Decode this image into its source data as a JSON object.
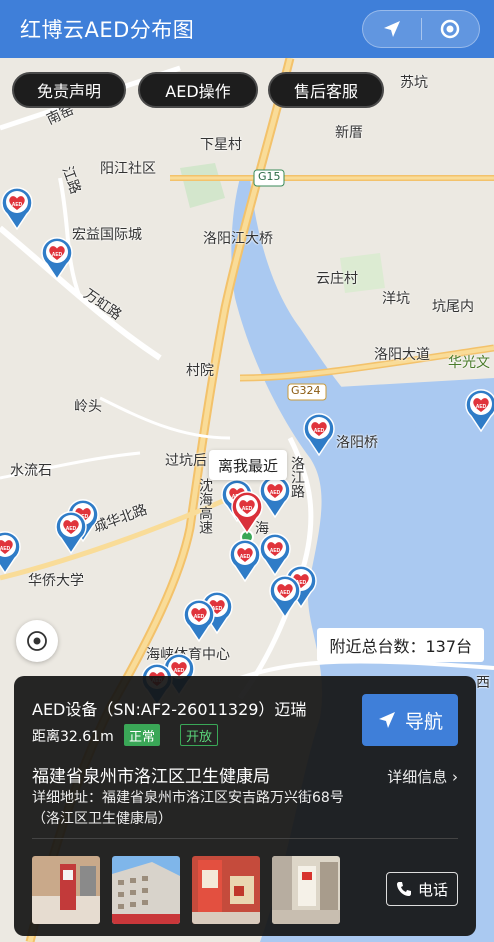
{
  "header": {
    "title": "红博云AED分布图",
    "icons": [
      "navigation-arrow-icon",
      "target-circle-icon"
    ]
  },
  "toolbar": {
    "disclaimer_label": "免责声明",
    "aed_operation_label": "AED操作",
    "after_sales_label": "售后客服"
  },
  "map": {
    "places": [
      {
        "key": "nanyao",
        "text": "南窑"
      },
      {
        "key": "suokeng",
        "text": "苏坑"
      },
      {
        "key": "xiaxingcun",
        "text": "下星村"
      },
      {
        "key": "xincuo",
        "text": "新厝"
      },
      {
        "key": "yangjiang",
        "text": "阳江社区"
      },
      {
        "key": "jiang",
        "text": "江路"
      },
      {
        "key": "g15",
        "text": "G15"
      },
      {
        "key": "hongyi",
        "text": "宏益国际城"
      },
      {
        "key": "luoyangbridge",
        "text": "洛阳江大桥"
      },
      {
        "key": "yunzhuang",
        "text": "云庄村"
      },
      {
        "key": "fanghong",
        "text": "万虹路"
      },
      {
        "key": "yangkeng",
        "text": "洋坑"
      },
      {
        "key": "kengwei",
        "text": "坑尾内"
      },
      {
        "key": "luoyangdadao",
        "text": "洛阳大道"
      },
      {
        "key": "huaguang",
        "text": "华光文"
      },
      {
        "key": "cunyuan",
        "text": "村院"
      },
      {
        "key": "g324",
        "text": "G324"
      },
      {
        "key": "lingtou",
        "text": "岭头"
      },
      {
        "key": "luoyangqiao",
        "text": "洛阳桥"
      },
      {
        "key": "luojianglu",
        "text": "洛江路"
      },
      {
        "key": "shuiliushi",
        "text": "水流石"
      },
      {
        "key": "guokeng",
        "text": "过坑后"
      },
      {
        "key": "chenhai",
        "text": "沈海高速"
      },
      {
        "key": "chenghua",
        "text": "城华北路"
      },
      {
        "key": "huaqiao",
        "text": "华侨大学"
      },
      {
        "key": "haixia",
        "text": "海峡体育中心"
      },
      {
        "key": "hai",
        "text": "海"
      },
      {
        "key": "west",
        "text": "西"
      }
    ],
    "nearest_label": "离我最近",
    "marker_text": "AED",
    "nearby_count": "附近总台数：137台"
  },
  "card": {
    "device": "AED设备（SN:AF2-26011329）迈瑞",
    "distance": "距离32.61m",
    "status_normal": "正常",
    "status_open": "开放",
    "nav_label": "导航",
    "org": "福建省泉州市洛江区卫生健康局",
    "more_label": "详细信息",
    "address": "详细地址：福建省泉州市洛江区安吉路万兴街68号（洛江区卫生健康局）",
    "call_label": "电话"
  },
  "colors": {
    "header": "#3f7fd9",
    "marker_blue": "#2f7cc7",
    "marker_red": "#d9303a",
    "water": "#a9c8f0",
    "road": "#f6d98b"
  }
}
